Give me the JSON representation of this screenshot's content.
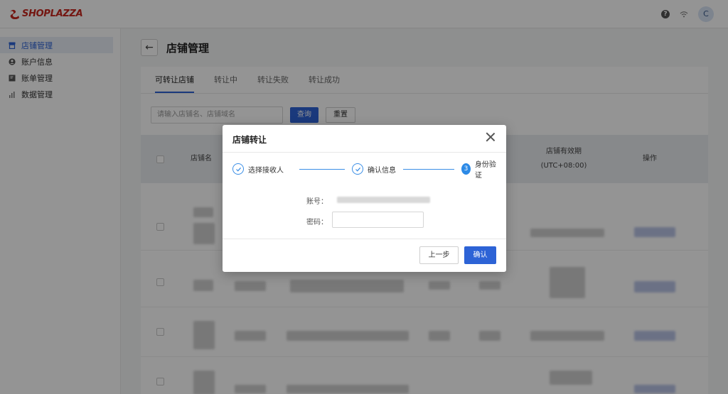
{
  "brand": {
    "logo_text": "SHOPLAZZA",
    "color": "#c8261e"
  },
  "topbar": {
    "help_icon": "question-circle-icon",
    "wifi_icon": "wifi-icon",
    "avatar_initial": "C"
  },
  "sidebar": {
    "items": [
      {
        "label": "店铺管理",
        "icon": "store-icon",
        "active": true
      },
      {
        "label": "账户信息",
        "icon": "user-circle-icon",
        "active": false
      },
      {
        "label": "账单管理",
        "icon": "bill-icon",
        "active": false
      },
      {
        "label": "数据管理",
        "icon": "bar-chart-icon",
        "active": false
      }
    ]
  },
  "page": {
    "back_symbol": "←",
    "title": "店铺管理",
    "tabs": [
      {
        "label": "可转让店铺",
        "active": true
      },
      {
        "label": "转让中",
        "active": false
      },
      {
        "label": "转让失败",
        "active": false
      },
      {
        "label": "转让成功",
        "active": false
      }
    ],
    "search": {
      "placeholder": "请输入店铺名、店铺域名"
    },
    "query_label": "查询",
    "reset_label": "重置",
    "table": {
      "columns": {
        "name": "店铺名",
        "validity_line1": "店铺有效期",
        "validity_line2": "(UTC+08:00)",
        "action": "操作"
      }
    }
  },
  "modal": {
    "title": "店铺转让",
    "steps": [
      {
        "index": "1",
        "label": "选择接收人",
        "state": "done"
      },
      {
        "index": "2",
        "label": "确认信息",
        "state": "done"
      },
      {
        "index": "3",
        "label": "身份验证",
        "state": "current"
      }
    ],
    "account_label": "账号：",
    "password_label": "密码：",
    "password_value": "",
    "prev_label": "上一步",
    "confirm_label": "确认"
  },
  "colors": {
    "primary": "#2d63d6",
    "step": "#3a8ee6",
    "overlay": "rgba(0,0,0,0.42)"
  }
}
